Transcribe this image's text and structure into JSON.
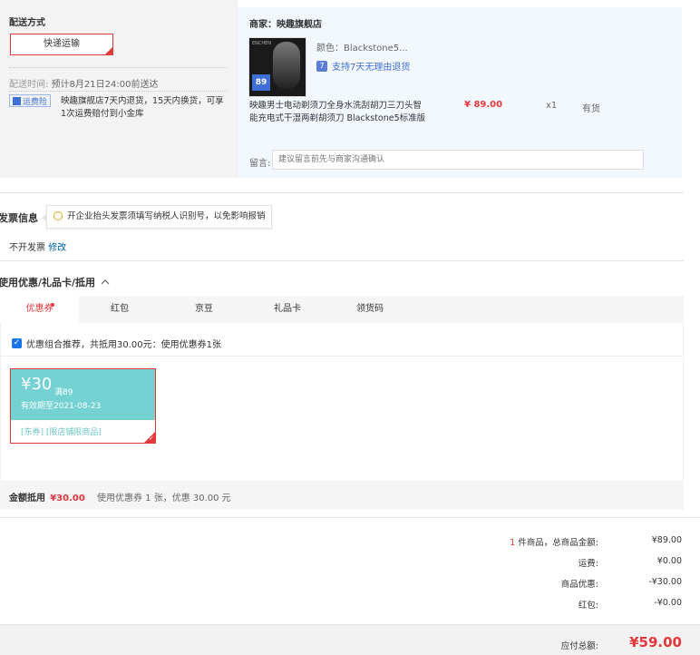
{
  "delivery": {
    "title": "配送方式",
    "method_label": "快递运输",
    "time_label": "配送时间:",
    "time_value": "预计8月21日24:00前送达",
    "insurance_badge": "运费险",
    "insurance_text_line1": "映趣旗舰店7天内退货，15天内换货，可享",
    "insurance_text_line2": "1次运费赔付到小金库"
  },
  "shop": {
    "name": "商家：映趣旗舰店",
    "product": {
      "thumb_tag": "89",
      "thumb_brand": "ENCHEN",
      "color_label": "颜色：Blackstone5...",
      "return_policy": "支持7天无理由退货",
      "return_badge": "7",
      "title_line1": "映趣男士电动剃须刀全身水洗刮胡刀三刀头智",
      "title_line2": "能充电式干湿两剃胡须刀 Blackstone5标准版",
      "price": "¥ 89.00",
      "quantity": "x1",
      "stock": "有货"
    },
    "remark_label": "留言:",
    "remark_placeholder": "建议留言前先与商家沟通确认"
  },
  "invoice": {
    "title": "发票信息",
    "tip": "开企业抬头发票须填写纳税人识别号，以免影响报销",
    "status": "不开发票",
    "edit_link": "修改"
  },
  "promo": {
    "title": "使用优惠/礼品卡/抵用",
    "tabs": [
      "优惠券",
      "红包",
      "京豆",
      "礼品卡",
      "领货码"
    ],
    "active_tab": "优惠券",
    "combo_text": "优惠组合推荐，共抵用30.00元：使用优惠券1张",
    "coupon": {
      "amount": "¥30",
      "condition": "满89",
      "expiry": "有效期至2021-08-23",
      "limits": "[东券]  [限店铺限商品]"
    },
    "discount_label": "金额抵用",
    "discount_amount": "¥30.00",
    "discount_detail": "使用优惠券 1 张，优惠 30.00 元"
  },
  "summary": {
    "count": "1",
    "count_label": " 件商品，总商品金额:",
    "goods_total": "¥89.00",
    "shipping_label": "运费:",
    "shipping": "¥0.00",
    "discount_label": "商品优惠:",
    "discount": "-¥30.00",
    "redpacket_label": "红包:",
    "redpacket": "-¥0.00",
    "payable_label": "应付总额:",
    "payable": "¥59.00"
  },
  "colors": {
    "accent_red": "#e4393c",
    "coupon_teal": "#74d2d3",
    "link_blue": "#005ea7",
    "shop_bg": "#f3f8fe"
  }
}
